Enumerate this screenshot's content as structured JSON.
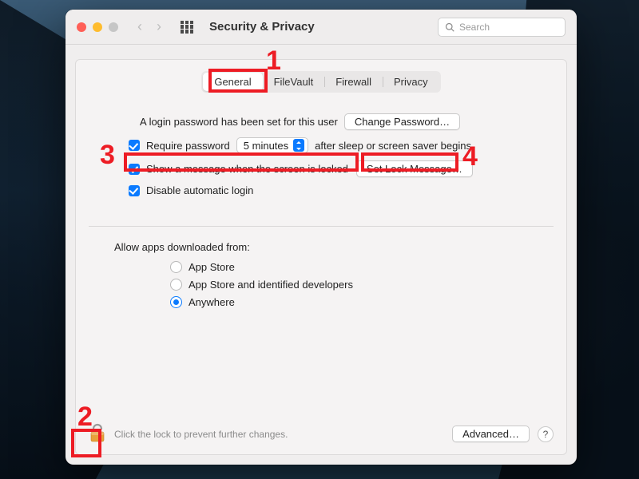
{
  "header": {
    "title": "Security & Privacy",
    "search_placeholder": "Search"
  },
  "tabs": [
    {
      "label": "General",
      "active": true
    },
    {
      "label": "FileVault",
      "active": false
    },
    {
      "label": "Firewall",
      "active": false
    },
    {
      "label": "Privacy",
      "active": false
    }
  ],
  "login_section": {
    "password_set_text": "A login password has been set for this user",
    "change_password_btn": "Change Password…",
    "require_password": {
      "checked": true,
      "prefix": "Require password",
      "delay_value": "5 minutes",
      "suffix": "after sleep or screen saver begins"
    },
    "lock_message": {
      "checked": true,
      "label": "Show a message when the screen is locked",
      "button": "Set Lock Message…"
    },
    "disable_auto_login": {
      "checked": true,
      "label": "Disable automatic login"
    }
  },
  "apps_section": {
    "heading": "Allow apps downloaded from:",
    "options": [
      {
        "label": "App Store",
        "selected": false
      },
      {
        "label": "App Store and identified developers",
        "selected": false
      },
      {
        "label": "Anywhere",
        "selected": true
      }
    ]
  },
  "footer": {
    "lock_hint": "Click the lock to prevent further changes.",
    "advanced_btn": "Advanced…",
    "help": "?"
  },
  "annotations": {
    "n1": "1",
    "n2": "2",
    "n3": "3",
    "n4": "4"
  }
}
